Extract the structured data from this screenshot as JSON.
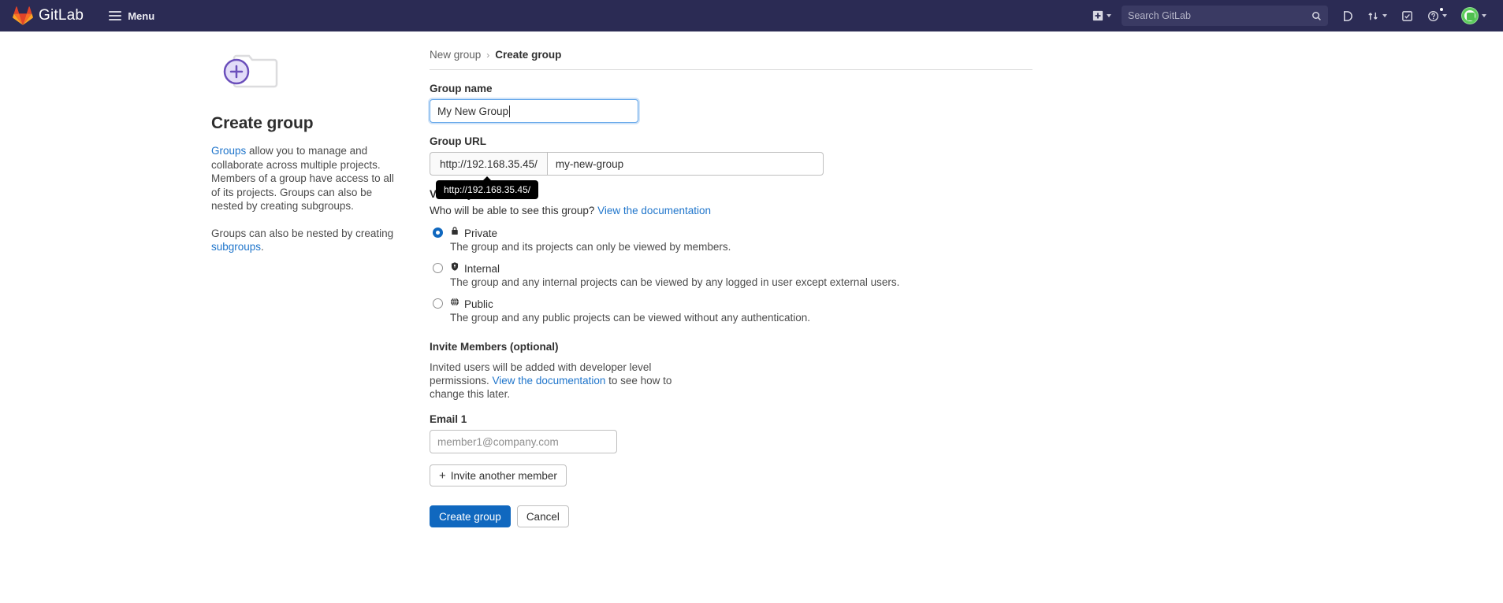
{
  "navbar": {
    "brand": "GitLab",
    "logo_icon": "gitlab-logo-icon",
    "menu_label": "Menu",
    "menu_icon": "hamburger-icon",
    "new_icon": "plus-square-icon",
    "search_placeholder": "Search GitLab",
    "search_icon": "search-icon",
    "issues_icon": "issues-icon",
    "merge_requests_icon": "merge-request-icon",
    "todos_icon": "todo-checkbox-icon",
    "help_icon": "question-circle-icon",
    "avatar_icon": "user-avatar"
  },
  "aside": {
    "folder_icon": "folder-plus-icon",
    "title": "Create group",
    "paragraph1_link": "Groups",
    "paragraph1": " allow you to manage and collaborate across multiple projects. Members of a group have access to all of its projects. Groups can also be nested by creating subgroups.",
    "paragraph2_pre": "Groups can also be nested by creating ",
    "paragraph2_link": "subgroups",
    "paragraph2_post": "."
  },
  "breadcrumb": {
    "parent": "New group",
    "separator": "›",
    "current": "Create group"
  },
  "form": {
    "group_name_label": "Group name",
    "group_name_value": "My New Group",
    "group_url_label": "Group URL",
    "group_url_prefix": "http://192.168.35.45/",
    "group_url_value": "my-new-group",
    "url_tooltip": "http://192.168.35.45/",
    "visibility_label": "Visibility level",
    "visibility_question": "Who will be able to see this group?",
    "visibility_doc_link": "View the documentation",
    "visibility_options": [
      {
        "icon": "lock-icon",
        "title": "Private",
        "description": "The group and its projects can only be viewed by members.",
        "selected": true
      },
      {
        "icon": "shield-icon",
        "title": "Internal",
        "description": "The group and any internal projects can be viewed by any logged in user except external users.",
        "selected": false
      },
      {
        "icon": "globe-icon",
        "title": "Public",
        "description": "The group and any public projects can be viewed without any authentication.",
        "selected": false
      }
    ],
    "invite_heading": "Invite Members (optional)",
    "invite_note_pre": "Invited users will be added with developer level permissions. ",
    "invite_note_link": "View the documentation",
    "invite_note_post": " to see how to change this later.",
    "email_label": "Email 1",
    "email_placeholder": "member1@company.com",
    "email_value": "",
    "invite_another_label": "Invite another member",
    "invite_another_icon": "plus-icon",
    "submit_label": "Create group",
    "cancel_label": "Cancel"
  },
  "colors": {
    "navbar_bg": "#2b2b54",
    "primary": "#1068bf",
    "link": "#1f75cb",
    "logo_orange": "#e24329"
  }
}
